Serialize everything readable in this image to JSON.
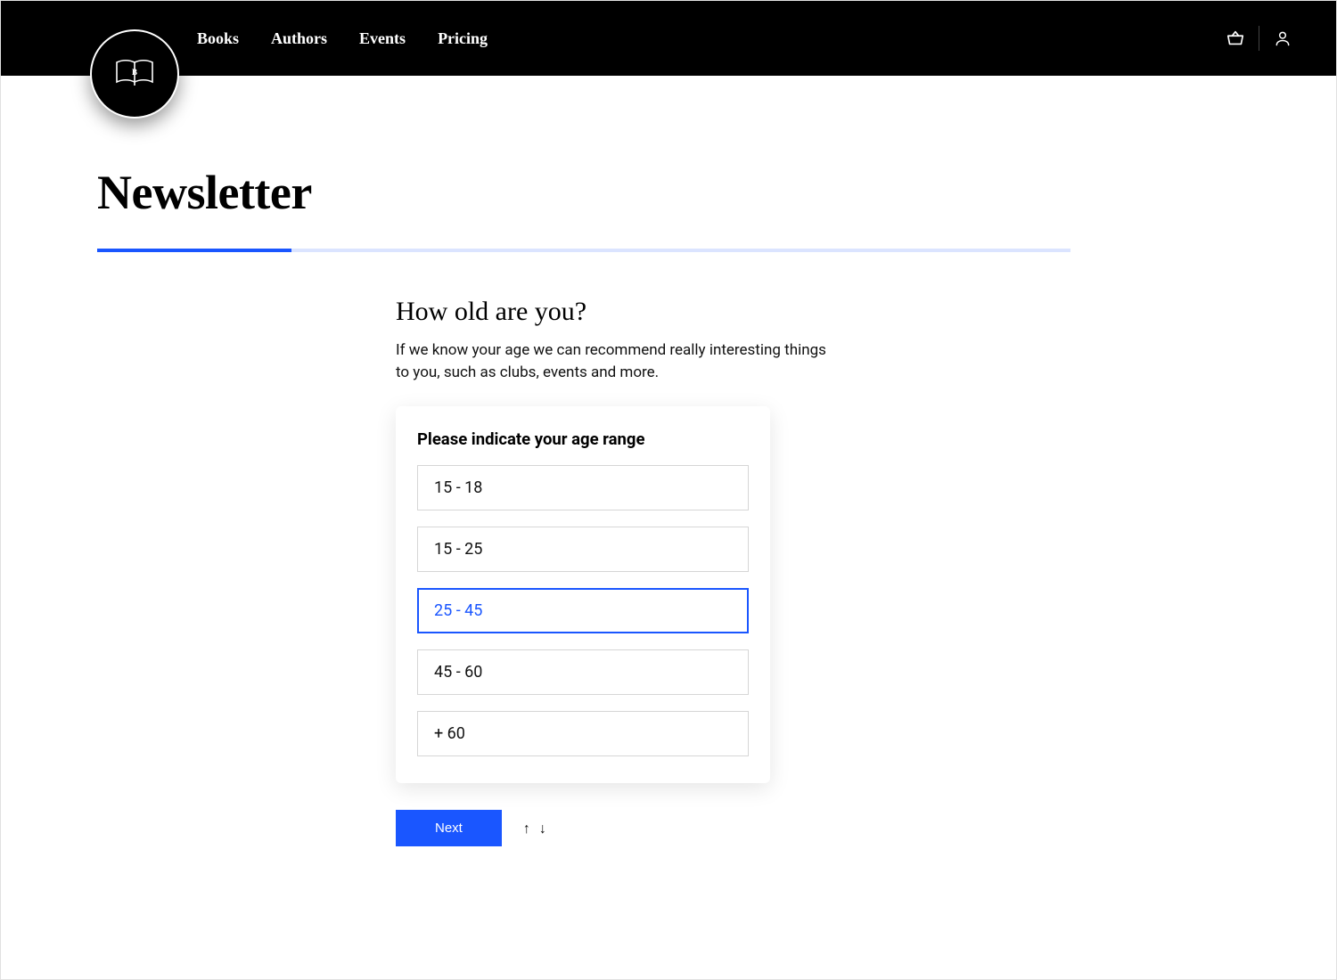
{
  "nav": {
    "items": [
      "Books",
      "Authors",
      "Events",
      "Pricing"
    ]
  },
  "page": {
    "title": "Newsletter"
  },
  "progress": {
    "percent": 20
  },
  "question": {
    "title": "How old are you?",
    "description": "If we know your age we can recommend really interesting things to you, such as clubs, events and more."
  },
  "card": {
    "heading": "Please indicate your age range",
    "options": [
      {
        "label": "15 - 18",
        "selected": false
      },
      {
        "label": "15 - 25",
        "selected": false
      },
      {
        "label": "25 - 45",
        "selected": true
      },
      {
        "label": "45 - 60",
        "selected": false
      },
      {
        "label": "+ 60",
        "selected": false
      }
    ]
  },
  "actions": {
    "next_label": "Next"
  },
  "icons": {
    "basket": "basket-icon",
    "user": "user-icon",
    "arrow_up": "↑",
    "arrow_down": "↓"
  }
}
